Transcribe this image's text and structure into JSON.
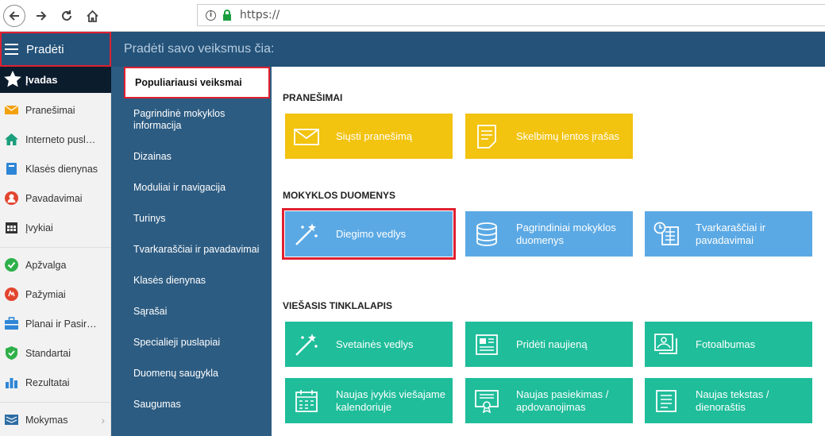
{
  "browser": {
    "url": "https://"
  },
  "left_nav": {
    "header": "Pradėti",
    "intro": "Įvadas",
    "items": [
      {
        "label": "Pranešimai",
        "icon": "envelope-icon"
      },
      {
        "label": "Interneto pusl…",
        "icon": "home-icon"
      },
      {
        "label": "Klasės dienynas",
        "icon": "book-icon"
      },
      {
        "label": "Pavadavimai",
        "icon": "user-icon"
      },
      {
        "label": "Įvykiai",
        "icon": "calendar-icon"
      },
      {
        "label": "Apžvalga",
        "icon": "check-circle-icon"
      },
      {
        "label": "Pažymiai",
        "icon": "grade-icon"
      },
      {
        "label": "Planai ir Pasir…",
        "icon": "briefcase-icon"
      },
      {
        "label": "Standartai",
        "icon": "shield-icon"
      },
      {
        "label": "Rezultatai",
        "icon": "bar-chart-icon"
      },
      {
        "label": "Mokymas",
        "icon": "education-icon"
      }
    ]
  },
  "main_header": "Pradėti savo veiksmus čia:",
  "menu": {
    "active": "Populiariausi veiksmai",
    "items": [
      "Pagrindinė mokyklos informacija",
      "Dizainas",
      "Moduliai ir navigacija",
      "Turinys",
      "Tvarkaraščiai ir pavadavimai",
      "Klasės dienynas",
      "Sąrašai",
      "Specialieji puslapiai",
      "Duomenų saugykla",
      "Saugumas"
    ]
  },
  "sections": {
    "notifications": {
      "title": "PRANEŠIMAI",
      "tiles": [
        {
          "label": "Siųsti pranešimą",
          "icon": "envelope-icon"
        },
        {
          "label": "Skelbimų lentos įrašas",
          "icon": "note-icon"
        }
      ]
    },
    "school_data": {
      "title": "MOKYKLOS DUOMENYS",
      "tiles": [
        {
          "label": "Diegimo vedlys",
          "icon": "magic-wand-icon"
        },
        {
          "label": "Pagrindiniai mokyklos duomenys",
          "icon": "database-icon"
        },
        {
          "label": "Tvarkaraščiai ir pavadavimai",
          "icon": "schedule-icon"
        }
      ]
    },
    "public_site": {
      "title": "VIEŠASIS TINKLALAPIS",
      "tiles": [
        {
          "label": "Svetainės vedlys",
          "icon": "magic-wand-icon"
        },
        {
          "label": "Pridėti naujieną",
          "icon": "newspaper-icon"
        },
        {
          "label": "Fotoalbumas",
          "icon": "photo-album-icon"
        },
        {
          "label": "Naujas įvykis viešajame kalendoriuje",
          "icon": "calendar-icon"
        },
        {
          "label": "Naujas pasiekimas / apdovanojimas",
          "icon": "certificate-icon"
        },
        {
          "label": "Naujas tekstas / dienoraštis",
          "icon": "text-icon"
        }
      ]
    }
  },
  "colors": {
    "header": "#245279",
    "menu": "#2d5c82",
    "yellow": "#f2c30f",
    "blue": "#5ba9e4",
    "green": "#1fbd9a",
    "highlight": "#e02030"
  }
}
